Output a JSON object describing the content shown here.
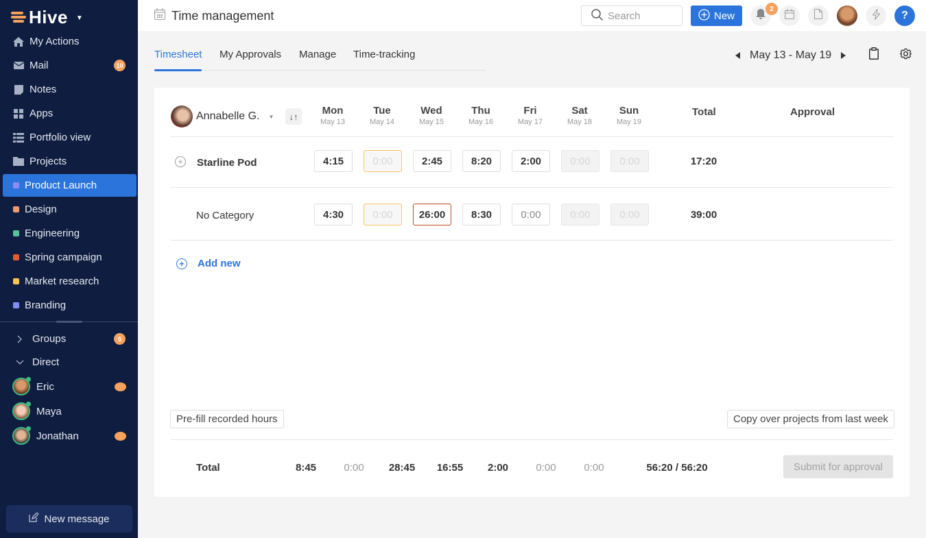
{
  "app": {
    "name": "Hive"
  },
  "sidebar": {
    "nav": [
      {
        "label": "My Actions",
        "icon": "home-icon"
      },
      {
        "label": "Mail",
        "icon": "mail-icon",
        "badge": "10"
      },
      {
        "label": "Notes",
        "icon": "note-icon"
      },
      {
        "label": "Apps",
        "icon": "apps-grid-icon"
      },
      {
        "label": "Portfolio view",
        "icon": "list-icon"
      },
      {
        "label": "Projects",
        "icon": "folder-icon"
      }
    ],
    "projects": [
      {
        "label": "Product Launch",
        "color": "#8e8cf0",
        "active": true
      },
      {
        "label": "Design",
        "color": "#f09a74"
      },
      {
        "label": "Engineering",
        "color": "#56c29a"
      },
      {
        "label": "Spring campaign",
        "color": "#e25b2e"
      },
      {
        "label": "Market research",
        "color": "#f8c44f"
      },
      {
        "label": "Branding",
        "color": "#7f8ff0"
      }
    ],
    "groups": {
      "label": "Groups",
      "badge": "5"
    },
    "direct": {
      "label": "Direct"
    },
    "dms": [
      {
        "name": "Eric",
        "unread": true
      },
      {
        "name": "Maya",
        "unread": false
      },
      {
        "name": "Jonathan",
        "unread": true
      }
    ],
    "new_message": "New message"
  },
  "topbar": {
    "title": "Time management",
    "search_placeholder": "Search",
    "new_label": "New",
    "notification_count": "2",
    "help_label": "?"
  },
  "tabs": [
    {
      "label": "Timesheet",
      "active": true
    },
    {
      "label": "My Approvals"
    },
    {
      "label": "Manage"
    },
    {
      "label": "Time-tracking"
    }
  ],
  "week": {
    "range": "May 13 - May 19"
  },
  "timesheet": {
    "user": "Annabelle G.",
    "days": [
      {
        "day": "Mon",
        "date": "May 13"
      },
      {
        "day": "Tue",
        "date": "May 14"
      },
      {
        "day": "Wed",
        "date": "May 15"
      },
      {
        "day": "Thu",
        "date": "May 16"
      },
      {
        "day": "Fri",
        "date": "May 17"
      },
      {
        "day": "Sat",
        "date": "May 18"
      },
      {
        "day": "Sun",
        "date": "May 19"
      }
    ],
    "total_header": "Total",
    "approval_header": "Approval",
    "rows": [
      {
        "label": "Starline Pod",
        "values": [
          "4:15",
          "0:00",
          "2:45",
          "8:20",
          "2:00",
          "0:00",
          "0:00"
        ],
        "total": "17:20"
      },
      {
        "label": "No Category",
        "values": [
          "4:30",
          "0:00",
          "26:00",
          "8:30",
          "0:00",
          "0:00",
          "0:00"
        ],
        "total": "39:00"
      }
    ],
    "add_new": "Add new",
    "prefill": "Pre-fill recorded hours",
    "copy_over": "Copy over projects from last week",
    "totals_label": "Total",
    "totals": [
      "8:45",
      "0:00",
      "28:45",
      "16:55",
      "2:00",
      "0:00",
      "0:00"
    ],
    "grand_total": "56:20 / 56:20",
    "submit": "Submit for approval"
  }
}
